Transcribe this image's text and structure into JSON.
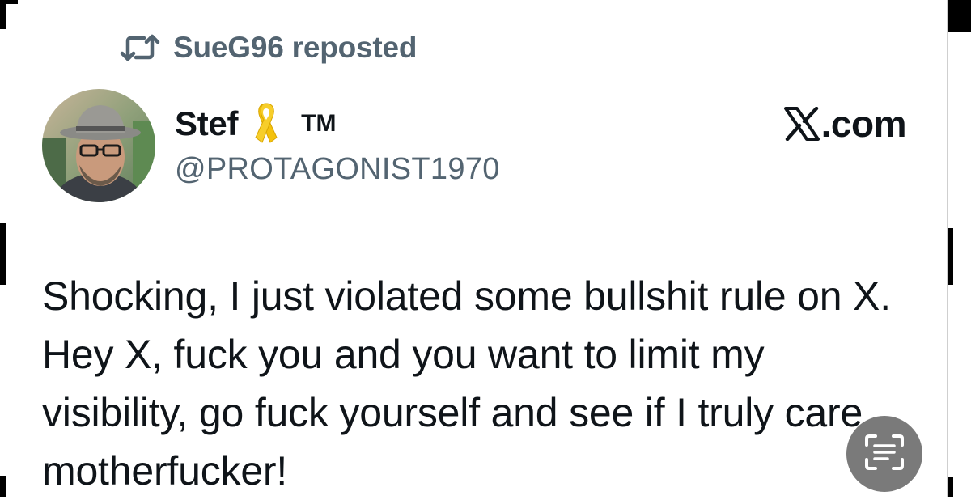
{
  "repost": {
    "icon": "repost-icon",
    "text": "SueG96 reposted"
  },
  "author": {
    "name": "Stef",
    "badge_icon": "yellow-ribbon-icon",
    "badge_color": "#f4c20d",
    "tm": "TM",
    "handle": "@PROTAGONIST1970"
  },
  "brand": {
    "icon": "x-logo-icon",
    "text": ".com"
  },
  "post": {
    "text": "Shocking, I just violated some bullshit rule on X. Hey X, fuck you and you want to limit my visibility, go fuck yourself and see if I truly care motherfucker!"
  },
  "overlay": {
    "icon": "live-text-scan-icon"
  },
  "colors": {
    "primary_text": "#0f1419",
    "secondary_text": "#536471",
    "background": "#ffffff"
  }
}
